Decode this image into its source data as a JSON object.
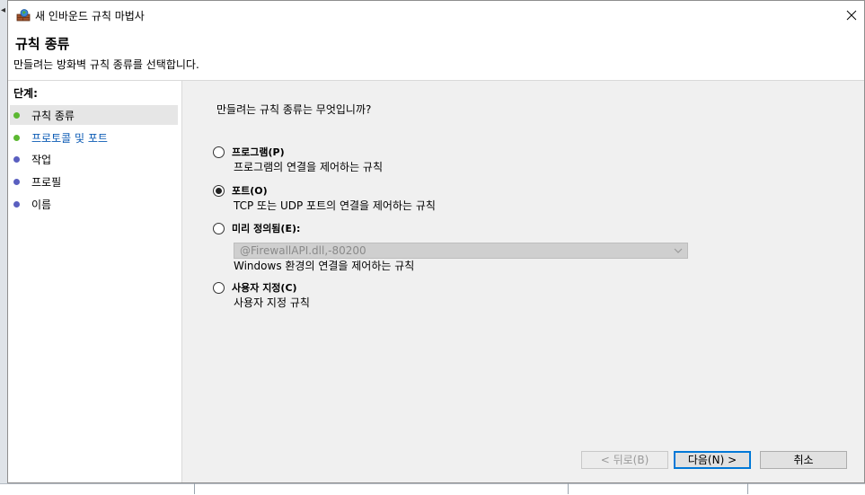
{
  "window": {
    "title": "새 인바운드 규칙 마법사"
  },
  "header": {
    "title": "규칙 종류",
    "subtitle": "만들려는 방화벽 규칙 종류를 선택합니다."
  },
  "steps": {
    "heading": "단계:",
    "items": [
      {
        "label": "규칙 종류",
        "status": "done",
        "color": "#5cb832"
      },
      {
        "label": "프로토콜 및 포트",
        "status": "done-link",
        "color": "#5cb832"
      },
      {
        "label": "작업",
        "status": "pending",
        "color": "#5a5fc0"
      },
      {
        "label": "프로필",
        "status": "pending",
        "color": "#5a5fc0"
      },
      {
        "label": "이름",
        "status": "pending",
        "color": "#5a5fc0"
      }
    ],
    "link_color": "#0a5ab4"
  },
  "main": {
    "question": "만들려는 규칙 종류는 무엇입니까?",
    "options": [
      {
        "label": "프로그램(P)",
        "description": "프로그램의 연결을 제어하는 규칙",
        "selected": false
      },
      {
        "label": "포트(O)",
        "description": "TCP 또는 UDP 포트의 연결을 제어하는 규칙",
        "selected": true
      },
      {
        "label": "미리 정의됨(E):",
        "description": "Windows 환경의 연결을 제어하는 규칙",
        "selected": false,
        "select_value": "@FirewallAPI.dll,-80200"
      },
      {
        "label": "사용자 지정(C)",
        "description": "사용자 지정 규칙",
        "selected": false
      }
    ]
  },
  "footer": {
    "back_label": "< 뒤로(B)",
    "next_label": "다음(N) >",
    "cancel_label": "취소"
  },
  "icons": {
    "app": "firewall-icon",
    "close": "close-icon",
    "select": "chevron-down-icon"
  }
}
